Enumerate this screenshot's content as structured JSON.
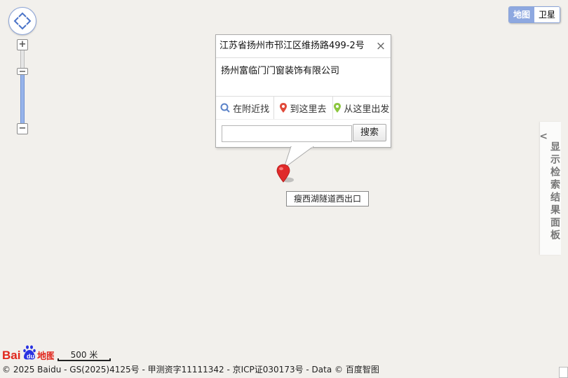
{
  "map_type": {
    "map_label": "地图",
    "satellite_label": "卫星"
  },
  "side_panel": {
    "label": "显示检索结果面板",
    "arrow": "<"
  },
  "info_window": {
    "address": "江苏省扬州市邗江区维扬路499-2号",
    "close_symbol": "×",
    "business_name": "扬州富临门门窗装饰有限公司",
    "actions": [
      {
        "label": "在附近找",
        "icon": "search-icon",
        "color": "#5a82c8"
      },
      {
        "label": "到这里去",
        "icon": "pin-icon",
        "color": "#e04a3a"
      },
      {
        "label": "从这里出发",
        "icon": "pin-icon",
        "color": "#8cc63f"
      }
    ],
    "search_value": "",
    "search_button": "搜索"
  },
  "marker": {
    "label": "瘦西湖隧道西出口",
    "color": "#e02a2a"
  },
  "scale": {
    "text": "500 米"
  },
  "logo": {
    "text": "Bai地图"
  },
  "copyright": "© 2025 Baidu - GS(2025)4125号 - 甲测资字11111342 - 京ICP证030173号 - Data © 百度智图"
}
